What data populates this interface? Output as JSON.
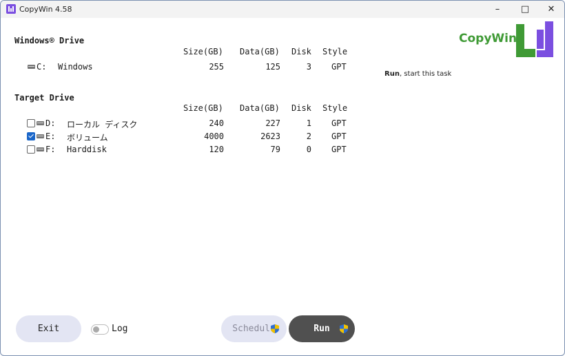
{
  "window": {
    "title": "CopyWin 4.58"
  },
  "brand": {
    "logo_text": "CopyWin",
    "colors": {
      "green": "#3f9a35",
      "purple": "#7b4fe0",
      "dark_button": "#505050",
      "light_button": "#e3e5f3"
    }
  },
  "hint": {
    "bold": "Run",
    "rest": ", start this task"
  },
  "headers": {
    "size": "Size(GB)",
    "data": "Data(GB)",
    "disk": "Disk",
    "style": "Style"
  },
  "windows_drive": {
    "title": "Windows® Drive",
    "row": {
      "letter": "C:",
      "name": "Windows",
      "size": "255",
      "data": "125",
      "disk": "3",
      "style": "GPT"
    }
  },
  "target_drive": {
    "title": "Target Drive",
    "rows": [
      {
        "checked": false,
        "letter": "D:",
        "name": "ローカル ディスク",
        "size": "240",
        "data": "227",
        "disk": "1",
        "style": "GPT"
      },
      {
        "checked": true,
        "letter": "E:",
        "name": "ボリューム",
        "size": "4000",
        "data": "2623",
        "disk": "2",
        "style": "GPT"
      },
      {
        "checked": false,
        "letter": "F:",
        "name": "Harddisk",
        "size": "120",
        "data": "79",
        "disk": "0",
        "style": "GPT"
      }
    ]
  },
  "buttons": {
    "exit": "Exit",
    "log": "Log",
    "log_on": false,
    "schedule": "Schedule",
    "run": "Run"
  },
  "icons": {
    "app": "copywin-app-icon",
    "drive": "drive-icon",
    "shield": "uac-shield-icon"
  }
}
